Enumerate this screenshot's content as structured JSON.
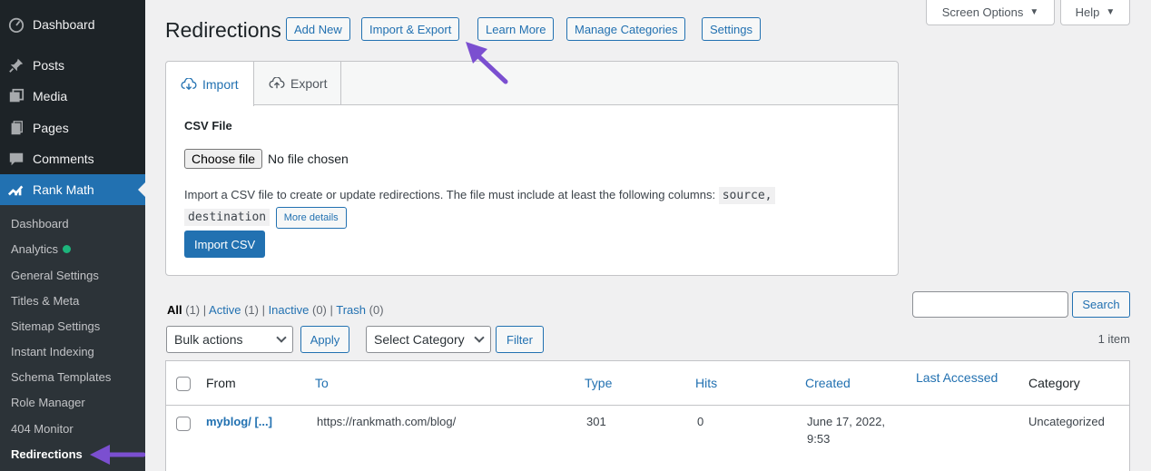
{
  "sidebar": {
    "main_items": [
      {
        "label": "Dashboard",
        "icon": "dashboard-icon"
      },
      {
        "label": "Posts",
        "icon": "pin-icon"
      },
      {
        "label": "Media",
        "icon": "media-icon"
      },
      {
        "label": "Pages",
        "icon": "pages-icon"
      },
      {
        "label": "Comments",
        "icon": "comment-icon"
      },
      {
        "label": "Rank Math",
        "icon": "rank-math-icon"
      }
    ],
    "sub_items": [
      {
        "label": "Dashboard"
      },
      {
        "label": "Analytics"
      },
      {
        "label": "General Settings"
      },
      {
        "label": "Titles & Meta"
      },
      {
        "label": "Sitemap Settings"
      },
      {
        "label": "Instant Indexing"
      },
      {
        "label": "Schema Templates"
      },
      {
        "label": "Role Manager"
      },
      {
        "label": "404 Monitor"
      },
      {
        "label": "Redirections"
      }
    ],
    "accent": "#2271b1",
    "status_dot_color": "#1db57c"
  },
  "screen_meta": {
    "screen_options": "Screen Options",
    "help": "Help"
  },
  "header": {
    "title": "Redirections",
    "buttons": [
      "Add New",
      "Import & Export",
      "Learn More",
      "Manage Categories",
      "Settings"
    ]
  },
  "panel": {
    "tabs": [
      {
        "label": "Import",
        "icon": "cloud-download-icon"
      },
      {
        "label": "Export",
        "icon": "cloud-upload-icon"
      }
    ],
    "csv_label": "CSV File",
    "choose_file": "Choose file",
    "no_file": "No file chosen",
    "description": "Import a CSV file to create or update redirections. The file must include at least the following columns:",
    "code_source": "source,",
    "code_destination": "destination",
    "more_details": "More details",
    "import_button": "Import CSV"
  },
  "filters": {
    "views": [
      {
        "label": "All",
        "count": "(1)"
      },
      {
        "label": "Active",
        "count": "(1)"
      },
      {
        "label": "Inactive",
        "count": "(0)"
      },
      {
        "label": "Trash",
        "count": "(0)"
      }
    ],
    "search_button": "Search",
    "bulk_actions": "Bulk actions",
    "apply": "Apply",
    "select_category": "Select Category",
    "filter": "Filter",
    "item_count": "1 item"
  },
  "table": {
    "columns": [
      "From",
      "To",
      "Type",
      "Hits",
      "Created",
      "Last Accessed",
      "Category"
    ],
    "rows": [
      {
        "from": "myblog/ [...]",
        "to": "https://rankmath.com/blog/",
        "type": "301",
        "hits": "0",
        "created_line1": "June 17, 2022,",
        "created_line2": "9:53",
        "last_accessed": "",
        "category": "Uncategorized"
      }
    ]
  },
  "annotation_color": "#7b4fd0"
}
